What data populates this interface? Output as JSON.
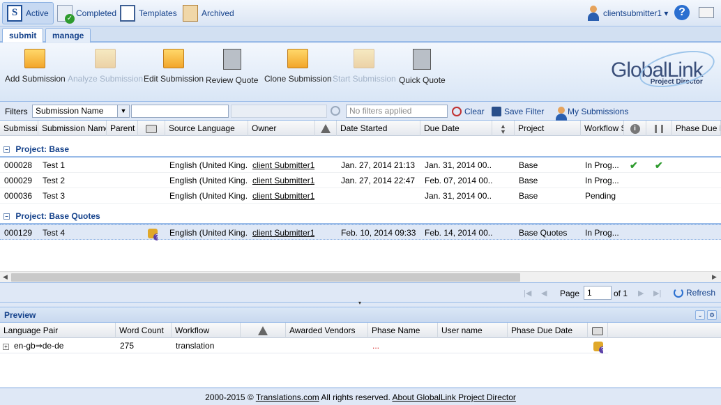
{
  "nav": {
    "active": "Active",
    "completed": "Completed",
    "templates": "Templates",
    "archived": "Archived",
    "active_icon_letter": "S",
    "user": "clientsubmitter1 ▾",
    "help": "?"
  },
  "tabs": {
    "submit": "submit",
    "manage": "manage"
  },
  "toolbar": {
    "add": "Add Submission",
    "analyze": "Analyze Submission",
    "edit": "Edit Submission",
    "review": "Review Quote",
    "clone": "Clone Submission",
    "start": "Start Submission",
    "quick": "Quick Quote"
  },
  "logo": {
    "main": "GlobalLink",
    "sub": "Project Director"
  },
  "filters": {
    "label": "Filters",
    "field": "Submission Name",
    "placeholder": "No filters applied",
    "clear": "Clear",
    "save": "Save Filter",
    "mine": "My Submissions"
  },
  "grid": {
    "columns": [
      "Submission",
      "Submission Name",
      "Parent",
      "",
      "Source Language",
      "Owner",
      "",
      "Date Started",
      "Due Date",
      "",
      "Project",
      "Workflow S",
      "",
      "",
      "Phase Due Da"
    ],
    "groups": [
      {
        "title": "Project: Base",
        "rows": [
          {
            "id": "000028",
            "name": "Test 1",
            "lang": "English (United King...",
            "owner": "client Submitter1",
            "started": "Jan. 27, 2014 21:13",
            "due": "Jan. 31, 2014 00...",
            "project": "Base",
            "workflow": "In Prog..."
          },
          {
            "id": "000029",
            "name": "Test 2",
            "lang": "English (United King...",
            "owner": "client Submitter1",
            "started": "Jan. 27, 2014 22:47",
            "due": "Feb. 07, 2014 00...",
            "project": "Base",
            "workflow": "In Prog..."
          },
          {
            "id": "000036",
            "name": "Test 3",
            "lang": "English (United King...",
            "owner": "client Submitter1",
            "started": "",
            "due": "Jan. 31, 2014 00...",
            "project": "Base",
            "workflow": "Pending"
          }
        ]
      },
      {
        "title": "Project: Base Quotes",
        "rows": [
          {
            "id": "000129",
            "name": "Test 4",
            "lang": "English (United King...",
            "owner": "client Submitter1",
            "started": "Feb. 10, 2014 09:33",
            "due": "Feb. 14, 2014 00...",
            "project": "Base Quotes",
            "workflow": "In Prog..."
          }
        ]
      }
    ]
  },
  "pager": {
    "page_label": "Page",
    "page": "1",
    "of": "of 1",
    "refresh": "Refresh"
  },
  "preview": {
    "title": "Preview",
    "columns": [
      "Language Pair",
      "Word Count",
      "Workflow",
      "",
      "Awarded Vendors",
      "Phase Name",
      "User name",
      "Phase Due Date",
      ""
    ],
    "row": {
      "pair": "en-gb⇒de-de",
      "count": "275",
      "workflow": "translation",
      "phase": "..."
    }
  },
  "footer": {
    "prefix": "2000-2015 ©",
    "link1": "Translations.com",
    "middle": "All rights reserved.",
    "link2": "About GlobalLink Project Director"
  }
}
